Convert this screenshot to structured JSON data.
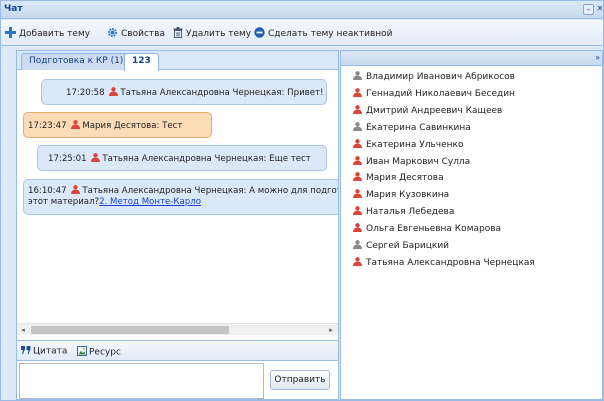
{
  "window": {
    "title": "Чат",
    "minimize_glyph": "–",
    "close_glyph": "✕"
  },
  "toolbar": {
    "add_topic": "Добавить тему",
    "properties": "Свойства",
    "delete_topic": "Удалить тему",
    "make_inactive": "Сделать тему неактивной"
  },
  "tabs": [
    {
      "label": "Подготовка к КР (1)",
      "active": false
    },
    {
      "label": "123",
      "active": true
    }
  ],
  "messages": [
    {
      "time": "17:20:58",
      "author": "Татьяна Александровна Чернецкая",
      "text": "Привет!",
      "mine": false,
      "online": false
    },
    {
      "time": "17:23:47",
      "author": "Мария Десятова",
      "text": "Тест",
      "mine": true,
      "online": false
    },
    {
      "time": "17:25:01",
      "author": "Татьяна Александровна Чернецкая",
      "text": "Еще тест",
      "mine": false,
      "online": false
    },
    {
      "time": "16:10:47",
      "author": "Татьяна Александровна Чернецкая",
      "text": "А можно для подготовки использовать",
      "text_line2": "этот материал?",
      "link": "2. Метод Монте-Карло",
      "mine": false,
      "online": false
    }
  ],
  "scroll": {
    "left_arrow": "◂",
    "right_arrow": "▸"
  },
  "compose": {
    "quote": "Цитата",
    "resource": "Ресурс",
    "input_value": "",
    "input_placeholder": "",
    "send": "Отправить"
  },
  "users_panel": {
    "collapse_glyph": "»",
    "users": [
      {
        "name": "Владимир Иванович Абрикосов",
        "online": false
      },
      {
        "name": "Геннадий Николаевич Беседин",
        "online": true
      },
      {
        "name": "Дмитрий Андреевич Кащеев",
        "online": true
      },
      {
        "name": "Екатерина Савинкина",
        "online": false
      },
      {
        "name": "Екатерина Ульченко",
        "online": true
      },
      {
        "name": "Иван Маркович Сулла",
        "online": true
      },
      {
        "name": "Мария Десятова",
        "online": true
      },
      {
        "name": "Мария Кузовкина",
        "online": true
      },
      {
        "name": "Наталья Лебедева",
        "online": true
      },
      {
        "name": "Ольга Евгеньевна Комарова",
        "online": true
      },
      {
        "name": "Сергей Барицкий",
        "online": false
      },
      {
        "name": "Татьяна Александровна Чернецкая",
        "online": true
      }
    ]
  },
  "colors": {
    "online_user": "#d9453a",
    "offline_user": "#8a8a8a",
    "add_icon": "#2c78c8",
    "gear_icon": "#2c78c8",
    "minus_icon": "#1f5fae",
    "quote_icon": "#1f4f8f"
  },
  "icons": {
    "add": "plus-icon",
    "properties": "gear-icon",
    "delete": "trash-icon",
    "inactive": "minus-circle-icon",
    "quote": "quote-icon",
    "resource": "image-icon",
    "user": "user-icon"
  }
}
